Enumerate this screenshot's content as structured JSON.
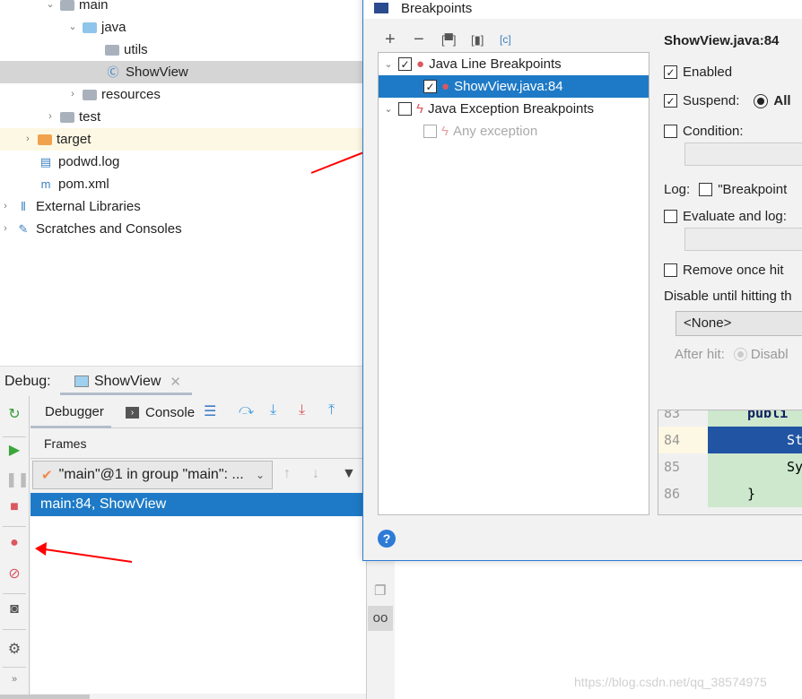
{
  "project_tree": [
    {
      "label": "main",
      "icon": "folder-icon",
      "depth": 2,
      "open": true
    },
    {
      "label": "java",
      "icon": "source-folder-icon",
      "depth": 3,
      "open": true
    },
    {
      "label": "utils",
      "icon": "package-icon",
      "depth": 4
    },
    {
      "label": "ShowView",
      "icon": "java-class-icon",
      "depth": 4,
      "selected": true
    },
    {
      "label": "resources",
      "icon": "resources-folder-icon",
      "depth": 3,
      "open": false
    },
    {
      "label": "test",
      "icon": "folder-icon",
      "depth": 2,
      "open": false
    },
    {
      "label": "target",
      "icon": "excluded-folder-icon",
      "depth": 1,
      "open": false
    },
    {
      "label": "podwd.log",
      "icon": "log-file-icon",
      "depth": 1
    },
    {
      "label": "pom.xml",
      "icon": "maven-icon",
      "depth": 1
    },
    {
      "label": "External Libraries",
      "icon": "libraries-icon",
      "depth": 0,
      "open": false
    },
    {
      "label": "Scratches and Consoles",
      "icon": "scratches-icon",
      "depth": 0,
      "open": false
    }
  ],
  "debug": {
    "label": "Debug:",
    "tab": "ShowView",
    "tabs": [
      "Debugger",
      "Console"
    ],
    "frames_label": "Frames",
    "thread": "\"main\"@1 in group \"main\": ...",
    "frame": "main:84, ShowView"
  },
  "dialog": {
    "title": "Breakpoints",
    "tree": [
      {
        "label": "Java Line Breakpoints",
        "checked": true
      },
      {
        "label": "ShowView.java:84",
        "checked": true,
        "selected": true
      },
      {
        "label": "Java Exception Breakpoints",
        "checked": false
      },
      {
        "label": "Any exception",
        "checked": false,
        "disabled": true
      }
    ],
    "heading": "ShowView.java:84",
    "enabled": "Enabled",
    "enabled_checked": true,
    "suspend": "Suspend:",
    "suspend_checked": true,
    "suspend_all": "All",
    "condition": "Condition:",
    "log_label": "Log:",
    "log_msg": "\"Breakpoint",
    "evaluate": "Evaluate and log:",
    "remove": "Remove once hit",
    "disable_until": "Disable until hitting th",
    "none": "<None>",
    "after_hit": "After hit:",
    "disable": "Disabl",
    "code": [
      {
        "n": "83",
        "t": "publi"
      },
      {
        "n": "84",
        "t": "St"
      },
      {
        "n": "85",
        "t": "Sy"
      },
      {
        "n": "86",
        "t": "}"
      }
    ]
  },
  "watermark": "https://blog.csdn.net/qq_38574975",
  "colors": {
    "selection": "#1e7ac6",
    "accent": "#2d7bd6",
    "breakpoint": "#db5860",
    "arrow": "#ff0000"
  }
}
